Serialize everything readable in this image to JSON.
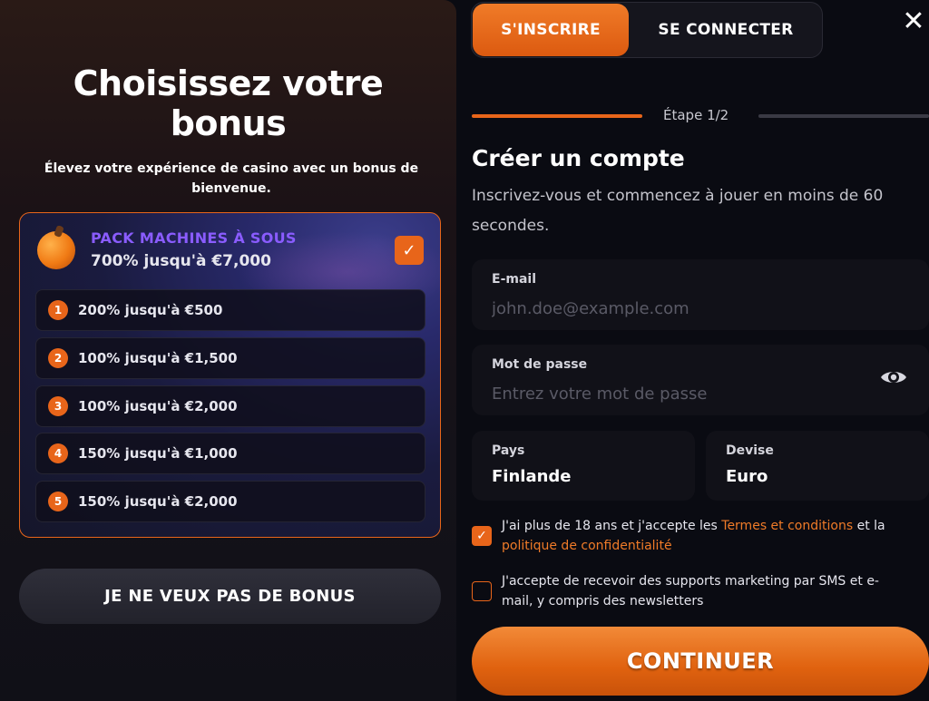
{
  "bonus_panel": {
    "title_line1": "Choisissez votre",
    "title_line2": "bonus",
    "subtitle": "Élevez votre expérience de casino avec un bonus de bienvenue.",
    "pack": {
      "title": "PACK MACHINES À SOUS",
      "amount": "700% jusqu'à €7,000",
      "selected": true,
      "icon": "fruit-icon"
    },
    "tiers": [
      {
        "num": "1",
        "label": "200% jusqu'à €500"
      },
      {
        "num": "2",
        "label": "100% jusqu'à €1,500"
      },
      {
        "num": "3",
        "label": "100% jusqu'à €2,000"
      },
      {
        "num": "4",
        "label": "150% jusqu'à €1,000"
      },
      {
        "num": "5",
        "label": "150% jusqu'à €2,000"
      }
    ],
    "no_bonus_label": "JE NE VEUX PAS DE BONUS"
  },
  "tabs": {
    "signup_label": "S'INSCRIRE",
    "login_label": "SE CONNECTER",
    "active": "signup"
  },
  "close_icon": "✕",
  "step": {
    "label": "Étape 1/2"
  },
  "form": {
    "title": "Créer un compte",
    "description": "Inscrivez-vous et commencez à jouer en moins de 60 secondes.",
    "email": {
      "label": "E-mail",
      "value": "",
      "placeholder": "john.doe@example.com"
    },
    "password": {
      "label": "Mot de passe",
      "value": "",
      "placeholder": "Entrez votre mot de passe",
      "icon": "eye-icon"
    },
    "country": {
      "label": "Pays",
      "value": "Finlande"
    },
    "currency": {
      "label": "Devise",
      "value": "Euro"
    },
    "consent_terms": {
      "checked": true,
      "text_before": "J'ai plus de 18 ans et j'accepte les ",
      "link1": "Termes et conditions",
      "text_middle": " et la ",
      "link2": "politique de confidentialité"
    },
    "consent_marketing": {
      "checked": false,
      "text": "J'accepte de recevoir des supports marketing par SMS et e-mail, y compris des newsletters"
    },
    "continue_label": "CONTINUER"
  },
  "colors": {
    "accent": "#e8651a",
    "pack_title": "#8a5cff",
    "background": "#0a0b12"
  }
}
